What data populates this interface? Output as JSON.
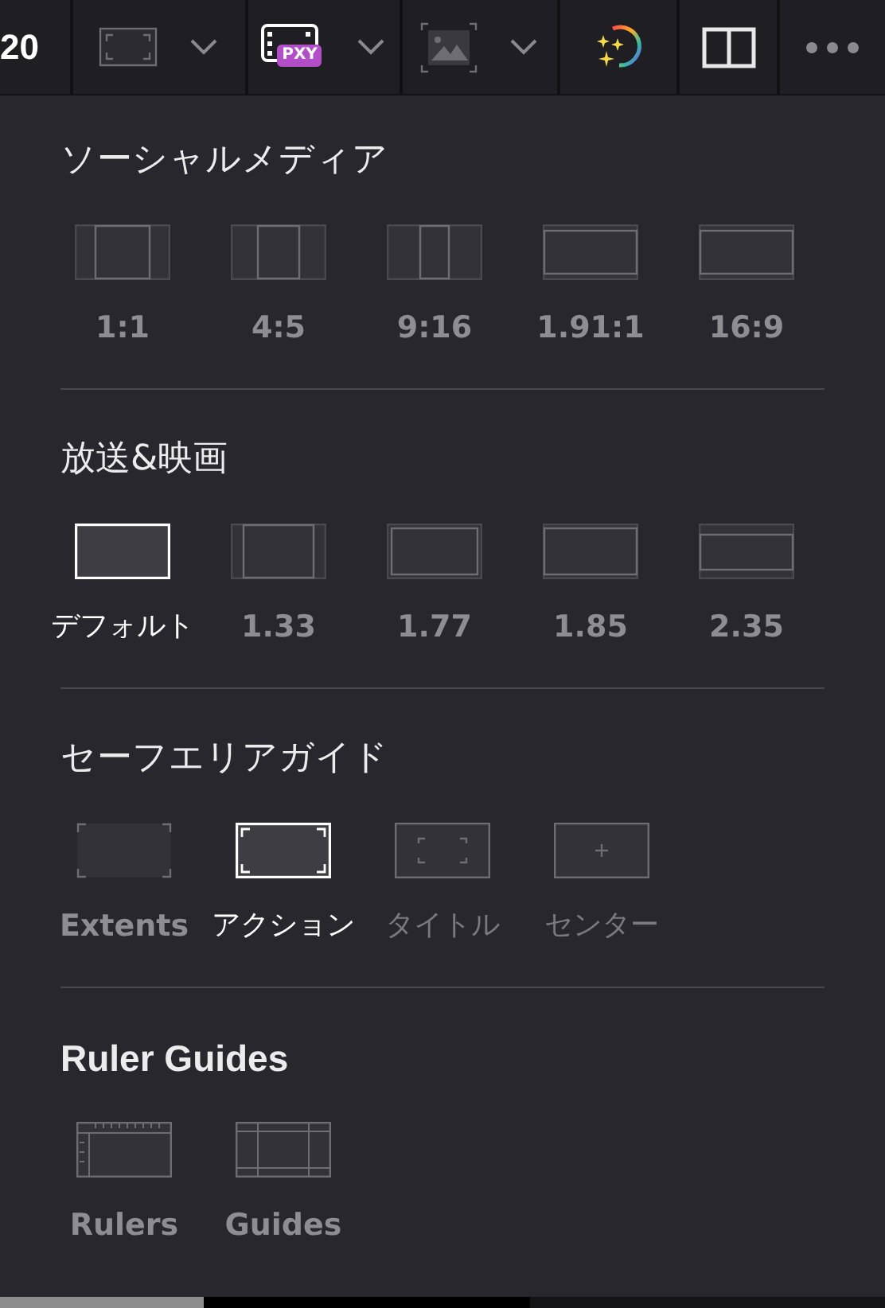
{
  "toolbar": {
    "cut_text": "20",
    "proxy_badge": "PXY"
  },
  "sections": [
    {
      "title": "ソーシャルメディア",
      "items": [
        {
          "label": "1:1",
          "kind": "pillar-wide",
          "selected": false
        },
        {
          "label": "4:5",
          "kind": "pillar-mid",
          "selected": false
        },
        {
          "label": "9:16",
          "kind": "pillar-narrow",
          "selected": false
        },
        {
          "label": "1.91:1",
          "kind": "letterbox-thin",
          "selected": false
        },
        {
          "label": "16:9",
          "kind": "letterbox-thin",
          "selected": false
        }
      ]
    },
    {
      "title": "放送&映画",
      "items": [
        {
          "label": "デフォルト",
          "kind": "plain",
          "selected": true
        },
        {
          "label": "1.33",
          "kind": "pillar-side",
          "selected": false
        },
        {
          "label": "1.77",
          "kind": "inset",
          "selected": false
        },
        {
          "label": "1.85",
          "kind": "inset-tall",
          "selected": false
        },
        {
          "label": "2.35",
          "kind": "letterbox-wide",
          "selected": false
        }
      ]
    },
    {
      "title": "セーフエリアガイド",
      "items": [
        {
          "label": "Extents",
          "kind": "corners",
          "selected": false
        },
        {
          "label": "アクション",
          "kind": "brackets-outer",
          "selected": true
        },
        {
          "label": "タイトル",
          "kind": "brackets-inner",
          "selected": false
        },
        {
          "label": "センター",
          "kind": "cross",
          "selected": false
        }
      ]
    },
    {
      "title": "Ruler Guides",
      "items": [
        {
          "label": "Rulers",
          "kind": "rulers",
          "selected": false
        },
        {
          "label": "Guides",
          "kind": "guides",
          "selected": false
        }
      ]
    }
  ]
}
